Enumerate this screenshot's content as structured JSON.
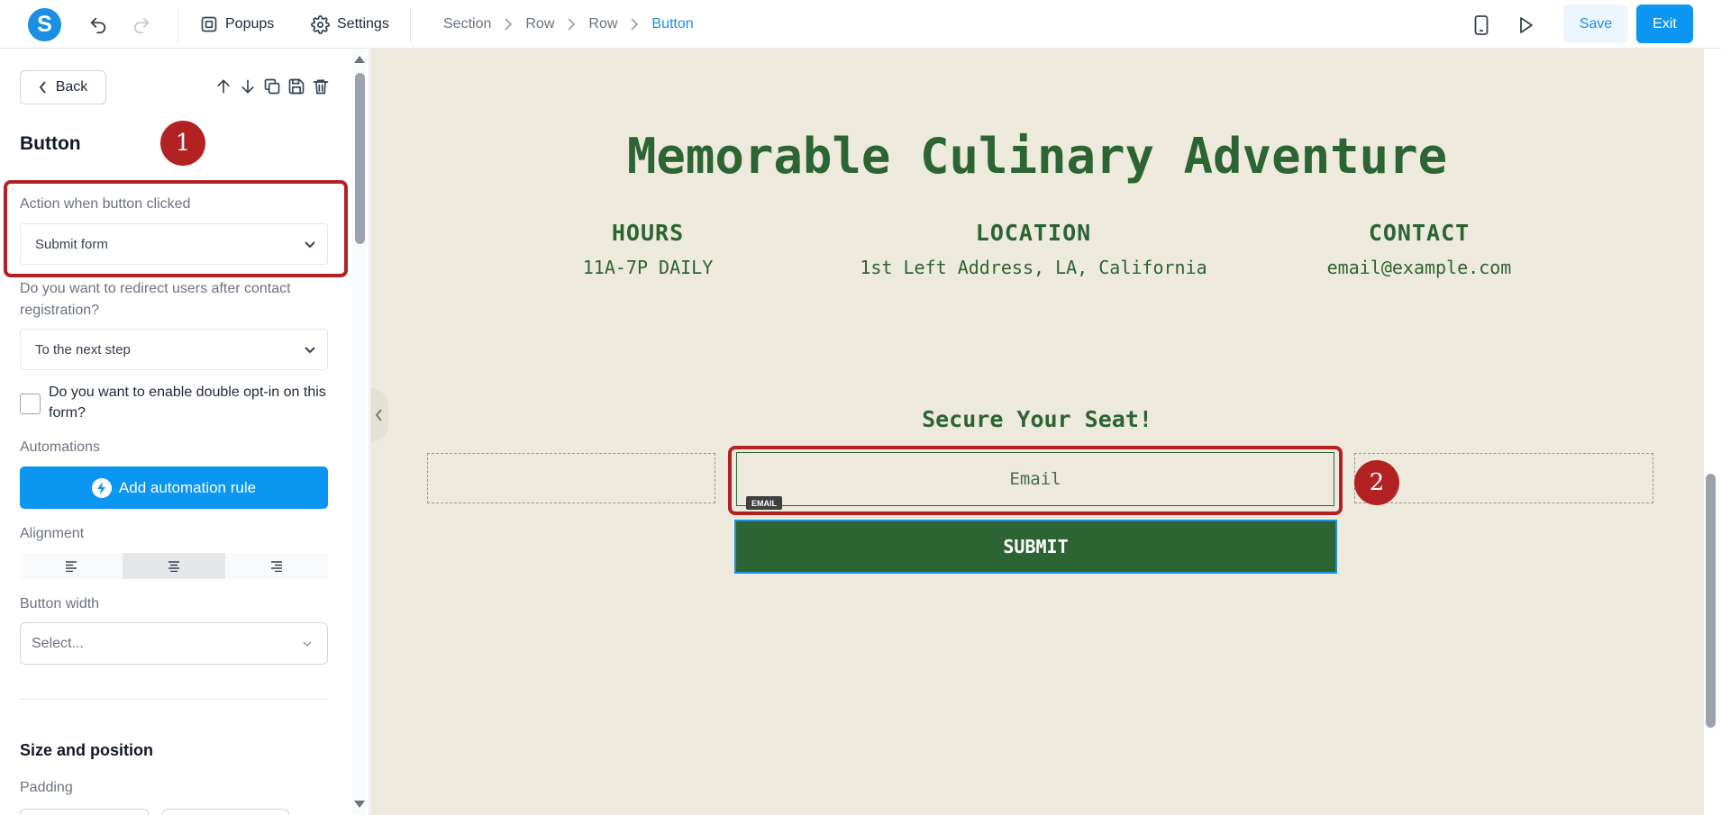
{
  "topbar": {
    "logo_letter": "S",
    "popups_label": "Popups",
    "settings_label": "Settings",
    "breadcrumb": [
      "Section",
      "Row",
      "Row",
      "Button"
    ],
    "save_label": "Save",
    "exit_label": "Exit"
  },
  "panel": {
    "back_label": "Back",
    "title": "Button",
    "action_label": "Action when button clicked",
    "action_value": "Submit form",
    "redirect_label": "Do you want to redirect users after contact registration?",
    "redirect_value": "To the next step",
    "double_optin_label": "Do you want to enable double opt-in on this form?",
    "double_optin_checked": false,
    "automations_label": "Automations",
    "add_automation_label": "Add automation rule",
    "alignment_label": "Alignment",
    "alignment_selected": "center",
    "button_width_label": "Button width",
    "button_width_placeholder": "Select...",
    "size_position_title": "Size and position",
    "padding_label": "Padding"
  },
  "markers": {
    "first": "1",
    "second": "2"
  },
  "canvas": {
    "hero_title": "Memorable Culinary Adventure",
    "info": [
      {
        "heading": "HOURS",
        "value": "11A-7P DAILY"
      },
      {
        "heading": "LOCATION",
        "value": "1st Left Address, LA, California"
      },
      {
        "heading": "CONTACT",
        "value": "email@example.com"
      }
    ],
    "form_title": "Secure Your Seat!",
    "email_placeholder": "Email",
    "email_tag": "EMAIL",
    "submit_label": "SUBMIT"
  },
  "colors": {
    "accent": "#0b96f2",
    "canvas_bg": "#ede9dc",
    "brand_green": "#2c6434",
    "highlight_red": "#b22222"
  }
}
